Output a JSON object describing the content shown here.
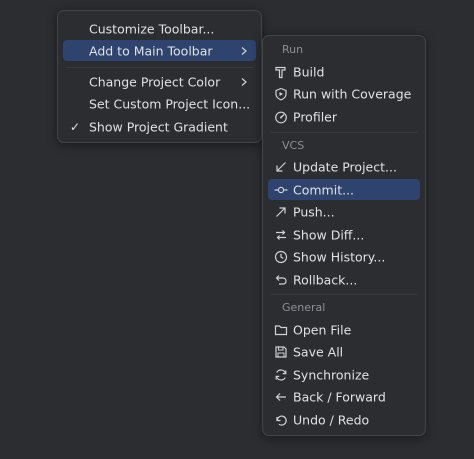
{
  "main_menu": {
    "items": [
      {
        "label": "Customize Toolbar..."
      },
      {
        "label": "Add to Main Toolbar"
      },
      {
        "label": "Change Project Color"
      },
      {
        "label": "Set Custom Project Icon..."
      },
      {
        "label": "Show Project Gradient",
        "checked": true
      }
    ]
  },
  "sub_menu": {
    "sections": {
      "run": "Run",
      "vcs": "VCS",
      "general": "General"
    },
    "items": {
      "build": "Build",
      "run_with_coverage": "Run with Coverage",
      "profiler": "Profiler",
      "update_project": "Update Project...",
      "commit": "Commit...",
      "push": "Push...",
      "show_diff": "Show Diff...",
      "show_history": "Show History...",
      "rollback": "Rollback...",
      "open_file": "Open File",
      "save_all": "Save All",
      "synchronize": "Synchronize",
      "back_forward": "Back / Forward",
      "undo_redo": "Undo / Redo"
    },
    "selected": "commit"
  },
  "colors": {
    "background": "#2b2d30",
    "selection": "#2e436e",
    "text": "#dfe1e5",
    "section_header": "#8c8f96"
  }
}
